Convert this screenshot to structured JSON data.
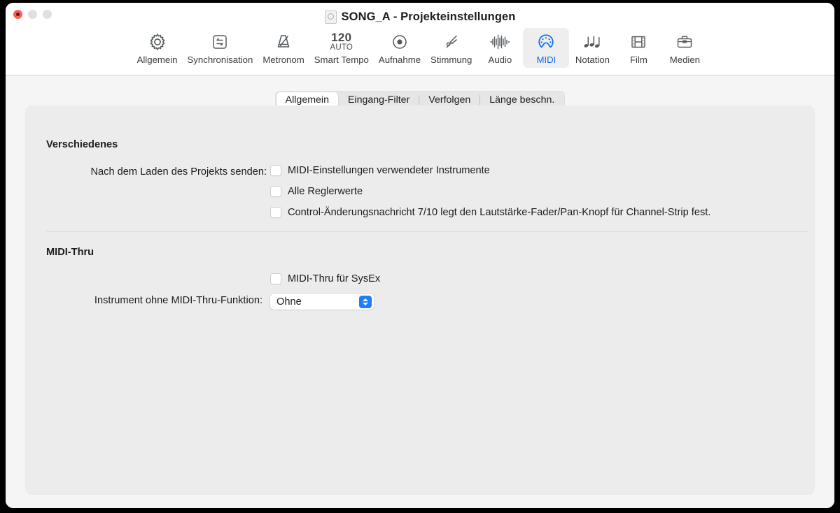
{
  "window": {
    "title": "SONG_A - Projekteinstellungen",
    "doc_icon": "document-icon",
    "traffic_lights": [
      {
        "name": "close",
        "color": "#fa6055"
      },
      {
        "name": "minimize",
        "color": "#e0e0e0"
      },
      {
        "name": "zoom",
        "color": "#e0e0e0"
      }
    ]
  },
  "toolbar": {
    "items": [
      {
        "label": "Allgemein",
        "icon": "gear-icon",
        "active": false
      },
      {
        "label": "Synchronisation",
        "icon": "sync-arrows-icon",
        "active": false
      },
      {
        "label": "Metronom",
        "icon": "metronome-icon",
        "active": false
      },
      {
        "label": "Smart Tempo",
        "icon": "smart-tempo-icon",
        "tempo": "120",
        "tempo_mode": "AUTO",
        "active": false
      },
      {
        "label": "Aufnahme",
        "icon": "record-circle-icon",
        "active": false
      },
      {
        "label": "Stimmung",
        "icon": "tuning-fork-icon",
        "active": false
      },
      {
        "label": "Audio",
        "icon": "waveform-icon",
        "active": false
      },
      {
        "label": "MIDI",
        "icon": "midi-plug-icon",
        "active": true
      },
      {
        "label": "Notation",
        "icon": "notes-icon",
        "active": false
      },
      {
        "label": "Film",
        "icon": "film-strip-icon",
        "active": false
      },
      {
        "label": "Medien",
        "icon": "briefcase-icon",
        "active": false
      }
    ],
    "accent_color": "#0a6cf0"
  },
  "tabs": [
    {
      "label": "Allgemein",
      "selected": true
    },
    {
      "label": "Eingang-Filter",
      "selected": false
    },
    {
      "label": "Verfolgen",
      "selected": false
    },
    {
      "label": "Länge beschn.",
      "selected": false
    }
  ],
  "panel": {
    "section_misc": {
      "title": "Verschiedenes",
      "send_label": "Nach dem Laden des Projekts senden:",
      "options": [
        {
          "label": "MIDI-Einstellungen verwendeter Instrumente",
          "checked": false
        },
        {
          "label": "Alle Reglerwerte",
          "checked": false
        },
        {
          "label": "Control-Änderungsnachricht 7/10 legt den Lautstärke-Fader/Pan-Knopf für Channel-Strip fest.",
          "checked": false
        }
      ]
    },
    "section_thru": {
      "title": "MIDI-Thru",
      "sysex": {
        "label": "MIDI-Thru für SysEx",
        "checked": false
      },
      "instrument_label": "Instrument ohne MIDI-Thru-Funktion:",
      "instrument_value": "Ohne"
    }
  }
}
